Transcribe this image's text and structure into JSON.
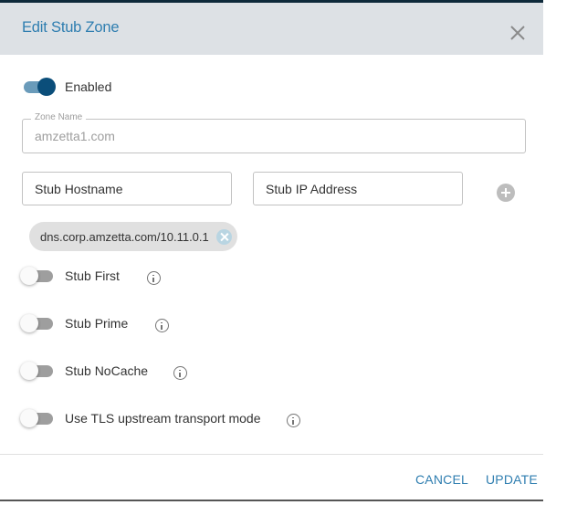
{
  "dialog": {
    "title": "Edit Stub Zone",
    "close_icon": "close-icon"
  },
  "enabled": {
    "label": "Enabled",
    "on": true
  },
  "zone_name": {
    "label": "Zone Name",
    "value": "amzetta1.com"
  },
  "stub_hostname": {
    "placeholder": "Stub Hostname",
    "value": ""
  },
  "stub_ip": {
    "placeholder": "Stub IP Address",
    "value": ""
  },
  "add_icon": "add-circle-icon",
  "chips": [
    {
      "label": "dns.corp.amzetta.com/10.11.0.1"
    }
  ],
  "options": [
    {
      "label": "Stub First",
      "on": false,
      "info_icon": "info-icon"
    },
    {
      "label": "Stub Prime",
      "on": false,
      "info_icon": "info-icon"
    },
    {
      "label": "Stub NoCache",
      "on": false,
      "info_icon": "info-icon"
    },
    {
      "label": "Use TLS upstream transport mode",
      "on": false,
      "info_icon": "info-icon"
    }
  ],
  "footer": {
    "cancel_label": "CANCEL",
    "update_label": "UPDATE"
  },
  "colors": {
    "accent": "#2f7eb0",
    "header_bg": "#dde1e5",
    "switch_on_thumb": "#0b4e7a",
    "switch_on_track": "#6a9bba"
  }
}
